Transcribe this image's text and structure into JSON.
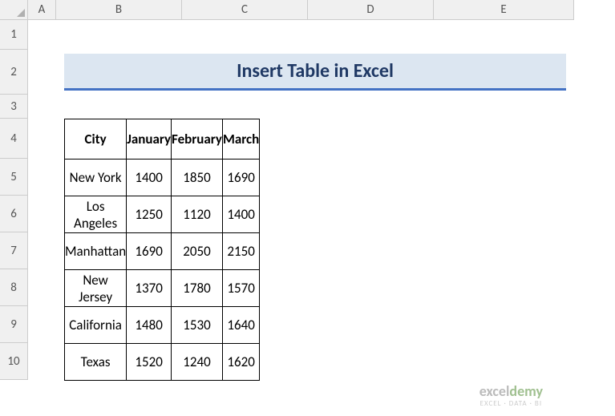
{
  "columns": [
    "A",
    "B",
    "C",
    "D",
    "E"
  ],
  "rows": [
    "1",
    "2",
    "3",
    "4",
    "5",
    "6",
    "7",
    "8",
    "9",
    "10"
  ],
  "title": "Insert Table in Excel",
  "table": {
    "headers": [
      "City",
      "January",
      "February",
      "March"
    ],
    "data": [
      [
        "New York",
        "1400",
        "1850",
        "1690"
      ],
      [
        "Los Angeles",
        "1250",
        "1120",
        "1400"
      ],
      [
        "Manhattan",
        "1690",
        "2050",
        "2150"
      ],
      [
        "New Jersey",
        "1370",
        "1780",
        "1570"
      ],
      [
        "California",
        "1480",
        "1530",
        "1640"
      ],
      [
        "Texas",
        "1520",
        "1240",
        "1620"
      ]
    ]
  },
  "watermark": {
    "brand_prefix": "excel",
    "brand_suffix": "demy",
    "tagline": "EXCEL · DATA · BI"
  }
}
